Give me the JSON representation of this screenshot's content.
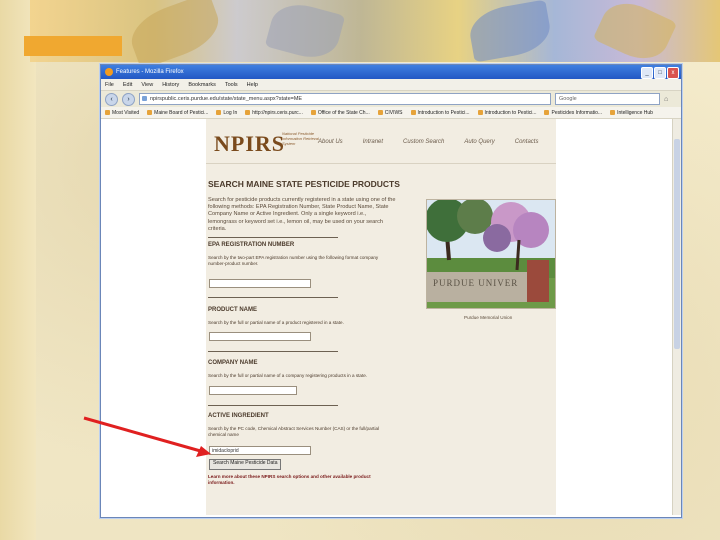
{
  "browser": {
    "title": "Features - Mozilla Firefox",
    "menu": [
      "File",
      "Edit",
      "View",
      "History",
      "Bookmarks",
      "Tools",
      "Help"
    ],
    "tab_label": "Features",
    "url": "npirspublic.ceris.purdue.edu/state/state_menu.aspx?state=ME",
    "search_placeholder": "Google",
    "bookmarks": [
      "Most Visited",
      "Maine Board of Pestici...",
      "Log In",
      "http://npirs.ceris.purc...",
      "Office of the State Ch...",
      "CIVIWS",
      "Introduction to Pestici...",
      "Introduction to Pestici...",
      "Pesticides Informatio...",
      "Intelligence Hub"
    ],
    "buttons": {
      "minimize": "_",
      "maximize": "□",
      "close": "x"
    }
  },
  "site": {
    "logo_text": "NPIRS",
    "logo_subtitle": "National Pesticide Information Retrieval System",
    "nav": [
      "About Us",
      "Intranet",
      "Custom Search",
      "Auto Query",
      "Contacts"
    ]
  },
  "page": {
    "title": "SEARCH MAINE STATE PESTICIDE PRODUCTS",
    "intro": "Search for pesticide products currently registered in a state using one of the following methods: EPA Registration Number, State Product Name, State Company Name or Active Ingredient. Only a single keyword i.e., lemongrass or keyword set i.e., lemon oil, may be used on your search criteria.",
    "epa": {
      "heading": "EPA REGISTRATION NUMBER",
      "desc": "Search by the two-part EPA registration number using the following format company number-product number.",
      "value": ""
    },
    "product": {
      "heading": "PRODUCT NAME",
      "desc": "Search by the full or partial name of a product registered in a state.",
      "value": ""
    },
    "company": {
      "heading": "COMPANY NAME",
      "desc": "Search by the full or partial name of a company registering products in a state.",
      "value": ""
    },
    "active": {
      "heading": "ACTIVE INGREDIENT",
      "desc": "Search by the PC code, Chemical Abstract Services Number (CAS) or the full/partial chemical name",
      "value": "imidacloprid"
    },
    "submit_label": "Search Maine Pesticide Data",
    "learn_more": "Learn more about these NPIRS search options and other available product information.",
    "photo_caption": "Purdue Memorial Union",
    "photo_sign_text": "PURDUE UNIVER"
  },
  "colors": {
    "arrow": "#e02020",
    "logo": "#7a4a1c",
    "page_bg": "#f2ede2"
  }
}
